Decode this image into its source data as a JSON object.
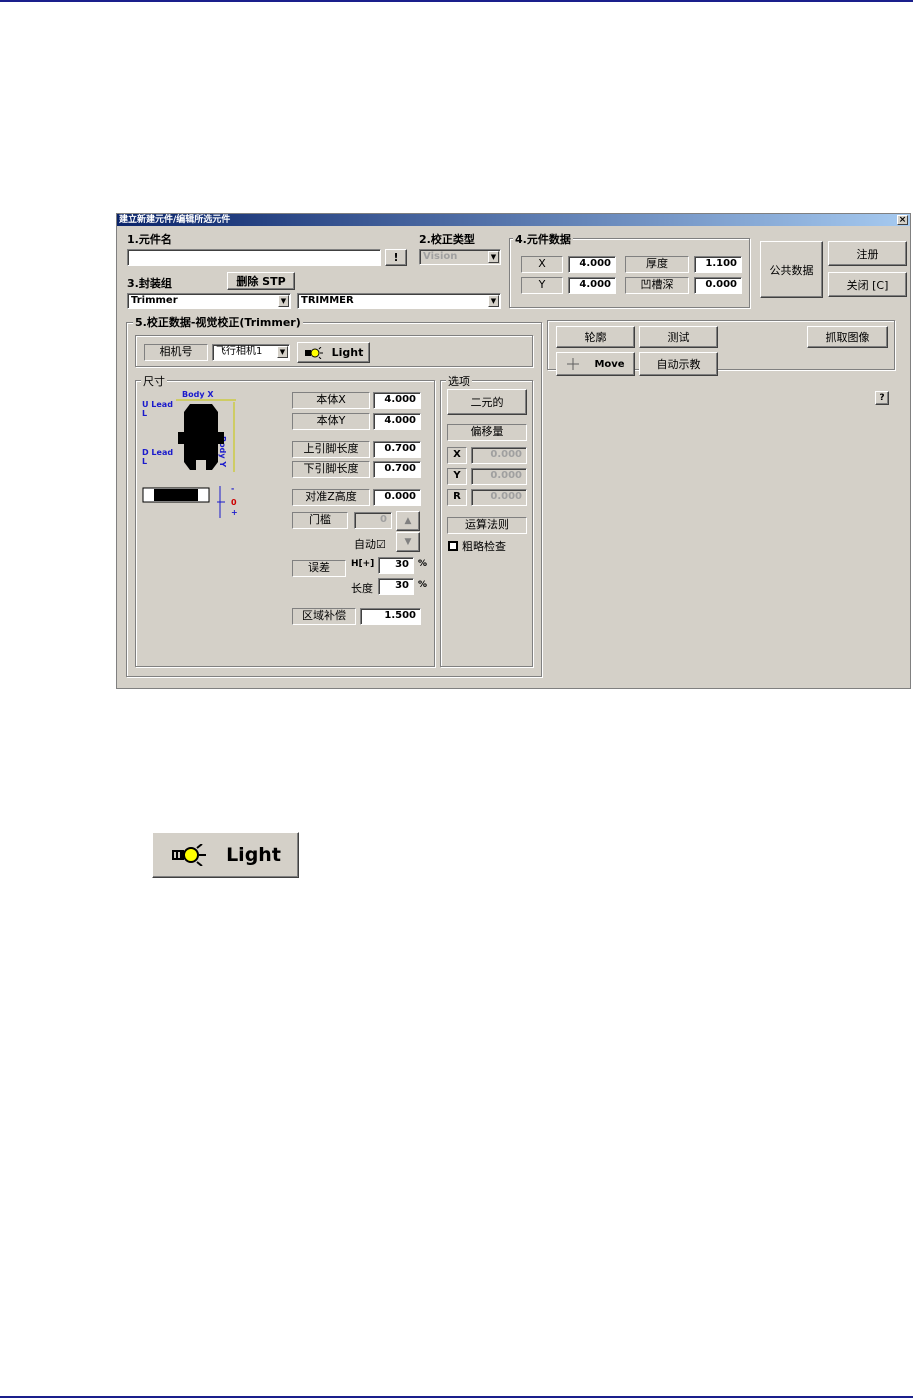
{
  "window": {
    "title": "建立新建元件/编辑所选元件",
    "close": "×"
  },
  "section1": {
    "label": "1.元件名",
    "name_value": "",
    "bang_button": "!"
  },
  "section2": {
    "label": "2.校正类型",
    "type_value": "Vision"
  },
  "section3": {
    "label": "3.封装组",
    "delete_button": "删除  STP",
    "package_value": "Trimmer",
    "package2_value": "TRIMMER"
  },
  "section4": {
    "label": "4.元件数据",
    "x_label": "X",
    "x_value": "4.000",
    "y_label": "Y",
    "y_value": "4.000",
    "thickness_label": "厚度",
    "thickness_value": "1.100",
    "groove_label": "凹槽深",
    "groove_value": "0.000"
  },
  "side_buttons": {
    "public": "公共数据",
    "register": "注册",
    "close": "关闭 [C]"
  },
  "section5": {
    "label": "5.校正数据-视觉校正(Trimmer)",
    "camera_label": "相机号",
    "camera_value": "飞行相机1",
    "light_button": "Light"
  },
  "size_group": {
    "title": "尺寸",
    "diagram": {
      "body_x": "Body X",
      "body_y": "Body Y",
      "u_lead": "U Lead",
      "u_l": "L",
      "d_lead": "D Lead",
      "d_l": "L",
      "minus": "-",
      "zero": "0",
      "plus": "+"
    },
    "body_x_label": "本体X",
    "body_x_value": "4.000",
    "body_y_label": "本体Y",
    "body_y_value": "4.000",
    "upper_lead_label": "上引脚长度",
    "upper_lead_value": "0.700",
    "lower_lead_label": "下引脚长度",
    "lower_lead_value": "0.700",
    "z_height_label": "对准Z高度",
    "z_height_value": "0.000",
    "threshold_label": "门槛",
    "threshold_value": "0",
    "auto_label": "自动☑",
    "error_label": "误差",
    "err_h_label": "H[+]",
    "err_h_value": "30",
    "err_h_unit": "%",
    "err_l_label": "长度",
    "err_l_value": "30",
    "err_l_unit": "%",
    "area_comp_label": "区域补偿",
    "area_comp_value": "1.500"
  },
  "options_group": {
    "title": "选项",
    "binary_button": "二元的",
    "offset_label": "偏移量",
    "x_label": "X",
    "x_value": "0.000",
    "y_label": "Y",
    "y_value": "0.000",
    "r_label": "R",
    "r_value": "0.000",
    "algorithm_button": "运算法则",
    "rough_check_label": "粗略检查"
  },
  "right_panel": {
    "outline_button": "轮廓",
    "test_button": "测试",
    "capture_button": "抓取图像",
    "move_button": "Move",
    "auto_teach_button": "自动示教",
    "help": "?"
  },
  "zoom_light_button": {
    "label": "Light"
  }
}
